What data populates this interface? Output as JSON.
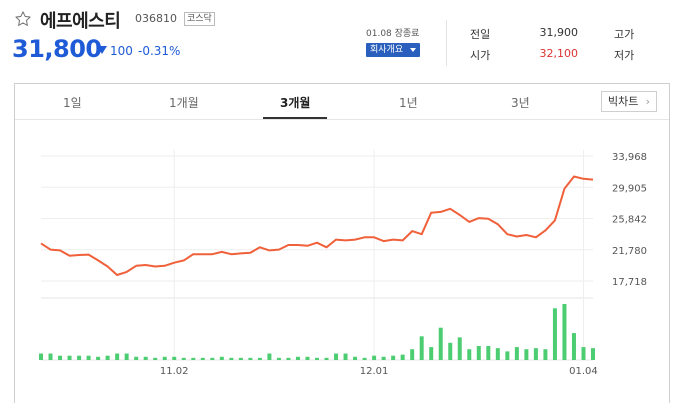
{
  "stock": {
    "name": "에프에스티",
    "code": "036810",
    "market": "코스닥",
    "price": "31,800",
    "change": "100",
    "change_pct": "-0.31%",
    "direction": "down",
    "closing_note": "01.08 장종료",
    "company_button": "회사개요"
  },
  "stats": {
    "prev_close_label": "전일",
    "prev_close": "31,900",
    "high_label": "고가",
    "open_label": "시가",
    "open": "32,100",
    "low_label": "저가"
  },
  "tabs": [
    {
      "label": "1일",
      "active": false
    },
    {
      "label": "1개월",
      "active": false
    },
    {
      "label": "3개월",
      "active": true
    },
    {
      "label": "1년",
      "active": false
    },
    {
      "label": "3년",
      "active": false
    }
  ],
  "big_chart_button": "빅차트",
  "colors": {
    "down": "#1f5bd6",
    "up": "#d33333",
    "line": "#f0603a",
    "volume": "#4ccd72"
  },
  "chart_data": {
    "type": "line",
    "y_ticks": [
      "33,968",
      "29,905",
      "25,842",
      "21,780",
      "17,718"
    ],
    "ylim": [
      17718,
      33968
    ],
    "x_ticks": [
      {
        "label": "11.02",
        "index": 14
      },
      {
        "label": "12.01",
        "index": 35
      },
      {
        "label": "01.04",
        "index": 57
      }
    ],
    "series": [
      {
        "values": [
          22600,
          21800,
          21700,
          21000,
          21100,
          21150,
          20400,
          19600,
          18500,
          18900,
          19700,
          19800,
          19600,
          19700,
          20100,
          20400,
          21200,
          21200,
          21200,
          21500,
          21200,
          21300,
          21400,
          22100,
          21700,
          21800,
          22400,
          22400,
          22300,
          22700,
          22100,
          23100,
          23000,
          23100,
          23400,
          23400,
          22900,
          23100,
          23000,
          24200,
          23800,
          26600,
          26700,
          27100,
          26300,
          25400,
          25900,
          25800,
          25100,
          23800,
          23500,
          23700,
          23400,
          24300,
          25600,
          29700,
          31300,
          31000,
          30900
        ]
      }
    ],
    "volume": [
      6,
      6,
      4,
      4,
      4,
      4,
      3,
      4,
      6,
      6,
      3,
      3,
      2,
      3,
      3,
      2,
      2,
      2,
      2,
      3,
      2,
      2,
      2,
      2,
      6,
      2,
      2,
      3,
      3,
      2,
      2,
      6,
      6,
      3,
      2,
      4,
      3,
      4,
      5,
      10,
      22,
      12,
      30,
      16,
      21,
      10,
      13,
      13,
      11,
      8,
      12,
      10,
      11,
      10,
      48,
      52,
      25,
      12,
      11
    ]
  }
}
